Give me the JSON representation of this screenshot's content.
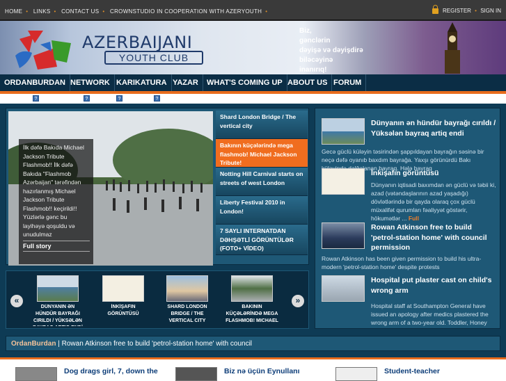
{
  "top_nav": {
    "links": [
      "HOME",
      "LINKS",
      "CONTACT US",
      "CROWNSTUDIO IN COOPERATION WITH AZERYOUTH"
    ],
    "register": "REGISTER",
    "sign_in": "SIGN IN"
  },
  "banner": {
    "title": "AZERBAIJANI",
    "subtitle": "YOUTH CLUB",
    "slogan_lines": [
      "Biz,",
      "gənclərin",
      "dəyişə və dəyişdirə",
      "biləcəyinə",
      "inanırıq!"
    ]
  },
  "main_nav": [
    "ORDANBURDAN",
    "NETWORK",
    "KARIKATURA",
    "YAZAR",
    "WHAT'S COMING UP",
    "ABOUT US",
    "FORUM"
  ],
  "icons": {
    "help": "?"
  },
  "colors": {
    "accent_orange": "#e86c1c",
    "nav_dark": "#0b2d45",
    "panel_blue": "#1e5876"
  },
  "feature": {
    "caption": "İlk dəfə Bakıda Michael Jackson Tribute Flashmob!! İlk dəfə Bakıda \"Flashmob Azərbaijan\" tərəfindən hazırlanmış Michael Jackson Tribute Flashmob!! keçirildi!! Yüzlərlə gənc bu layihəyə qoşuldu və unudulmaz",
    "full_story": "Full story",
    "headlines": [
      "Shard London Bridge / The vertical city",
      "Bakının küçələrində mega flashmob! Michael Jackson Tribute!",
      "Notting Hill Carnival starts on streets of west London",
      "Liberty Festival 2010 in London!",
      "7 SAYLI INTERNATDAN DƏHŞƏTLİ GÖRÜNTÜLƏR (FOTO+ VİDEO)"
    ]
  },
  "carousel": {
    "prev": "«",
    "next": "»",
    "items": [
      "DÜNYANIN ƏN HÜNDÜR BAYRAĞI CIRILDI / YÜKSƏLƏN BAYRAQ ARTIQ ENDİ",
      "İNKİŞAFIN GÖRÜNTÜSÜ",
      "SHARD LONDON BRIDGE / THE VERTICAL CITY",
      "BAKININ KÜÇƏLƏRİNDƏ MEGA FLASHMOB! MICHAEL"
    ]
  },
  "news": [
    {
      "title": "Dünyanın ən hündür bayrağı cırıldı / Yüksələn bayraq artiq endi",
      "body": "Gecə güclü küləyin təsirindən şappıldayan bayrağın səsinə bir neçə dəfə oyanıb baxdım bayrağa. Yaxşı görünürdü Bakı küləyində dalğalanan bayraq. Hələ bayraq"
    },
    {
      "title": "İnkişafın görüntüsü",
      "body": "Dünyanın iqtisadi baxımdan ən güclü və təbii ki, azad (vətəndaşlarının azad yaşadığı) dövlətlərində bir qayda olaraq çox güclü müxalifət qurumları fəaliyyət göstərir, hökumətlər ...",
      "more": "Full"
    },
    {
      "title": "Rowan Atkinson free to build 'petrol-station home' with council permission",
      "body": "Rowan Atkinson has been given permission to build his ultra-modern 'petrol-station home' despite protests"
    },
    {
      "title": "Hospital put plaster cast on child's wrong arm",
      "body": "Hospital staff at Southampton General have issued an apology after medics plastered the wrong arm of a two-year old. Toddler, Honey Wight,"
    }
  ],
  "ticker": {
    "label": "OrdanBurdan",
    "separator": "|",
    "text": "Rowan Atkinson free to build 'petrol-station home' with council"
  },
  "bottom": [
    "Dog drags girl, 7, down the",
    "Biz nə üçün Eynullanı",
    "Student-teacher"
  ]
}
